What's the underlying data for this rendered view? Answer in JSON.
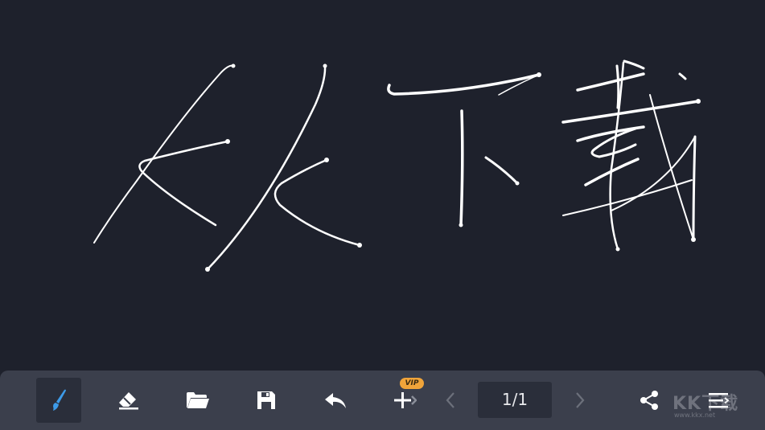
{
  "canvas": {
    "background_color": "#1e212c",
    "ink_color": "#ffffff",
    "handwriting_text": "Kk下載"
  },
  "toolbar": {
    "background_color": "#3b3f4c",
    "active_tool": "brush",
    "tools": [
      {
        "name": "brush",
        "icon": "paintbrush-icon",
        "color": "#3d9be9"
      },
      {
        "name": "eraser",
        "icon": "eraser-icon"
      },
      {
        "name": "open",
        "icon": "folder-open-icon"
      },
      {
        "name": "save",
        "icon": "floppy-disk-icon"
      },
      {
        "name": "undo",
        "icon": "undo-arrow-icon"
      },
      {
        "name": "add-page",
        "icon": "plus-icon"
      }
    ],
    "vip_badge": "VIP",
    "vip_color": "#f0a43a",
    "prev_icon": "chevron-left-icon",
    "page_indicator": "1/1",
    "next_icon": "chevron-right-icon",
    "share_icon": "share-icon",
    "menu_icon": "menu-icon"
  },
  "watermark": {
    "text": "KK下载",
    "url": "www.kkx.net"
  }
}
